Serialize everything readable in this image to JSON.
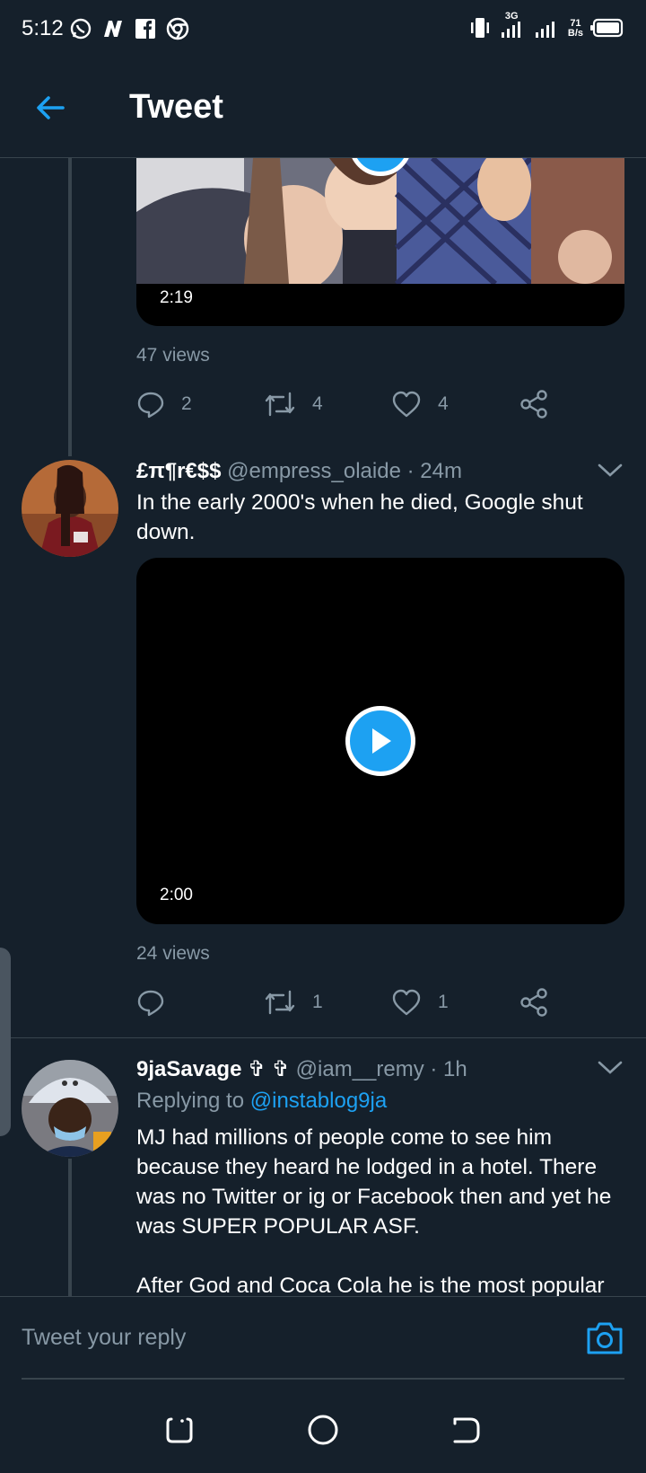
{
  "status_bar": {
    "time": "5:12",
    "network": "3G",
    "speed_value": "71",
    "speed_unit": "B/s"
  },
  "header": {
    "title": "Tweet"
  },
  "tweet_top": {
    "duration": "2:19",
    "views": "47 views",
    "replies": "2",
    "retweets": "4",
    "likes": "4"
  },
  "tweet_reply1": {
    "name": "£π¶r€$$",
    "handle": "@empress_olaide",
    "time": "· 24m",
    "text": "In the early 2000's when he died, Google shut down.",
    "duration": "2:00",
    "views": "24 views",
    "replies": "",
    "retweets": "1",
    "likes": "1"
  },
  "tweet_reply2": {
    "name": "9jaSavage ✞ ✞",
    "handle": "@iam__remy",
    "time": "· 1h",
    "replying_prefix": "Replying to",
    "replying_to": "@instablog9ja",
    "text_p1": "MJ had millions of people come to see him because they heard he lodged in a hotel. There was no Twitter or ig or Facebook then and yet he was SUPER POPULAR ASF.",
    "text_p2": "After God and Coca Cola he is the most popular"
  },
  "reply_bar": {
    "placeholder": "Tweet your reply"
  },
  "colors": {
    "background": "#15202b",
    "accent": "#1da1f2",
    "muted": "#8899a6",
    "border": "#38444d"
  }
}
